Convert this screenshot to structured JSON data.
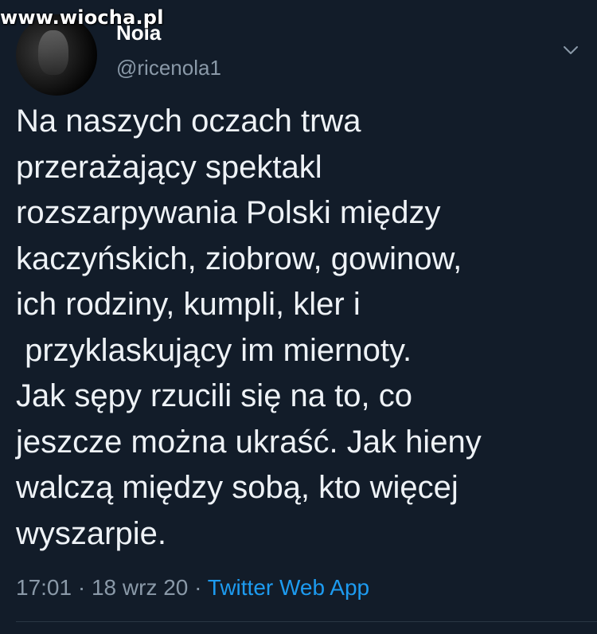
{
  "watermark": "www.wiocha.pl",
  "tweet": {
    "display_name": "Nola",
    "handle": "@ricenola1",
    "text_lines": [
      "Na naszych oczach trwa",
      "przerażający spektakl",
      "rozszarpywania Polski między",
      "kaczyńskich, ziobrow, gowinow,",
      "ich rodziny, kumpli, kler i",
      " przyklaskujący im miernoty.",
      "Jak sępy rzucili się na to, co",
      "jeszcze można ukraść. Jak hieny",
      "walczą między sobą, kto więcej",
      "wyszarpie."
    ],
    "time": "17:01",
    "separator": " · ",
    "date": "18 wrz 20",
    "app": "Twitter Web App"
  },
  "icons": {
    "menu": "chevron-down-icon",
    "avatar": "avatar"
  },
  "colors": {
    "background": "#121c29",
    "text": "#eef2f6",
    "secondary": "#8a99a8",
    "link": "#1d9bf0"
  }
}
